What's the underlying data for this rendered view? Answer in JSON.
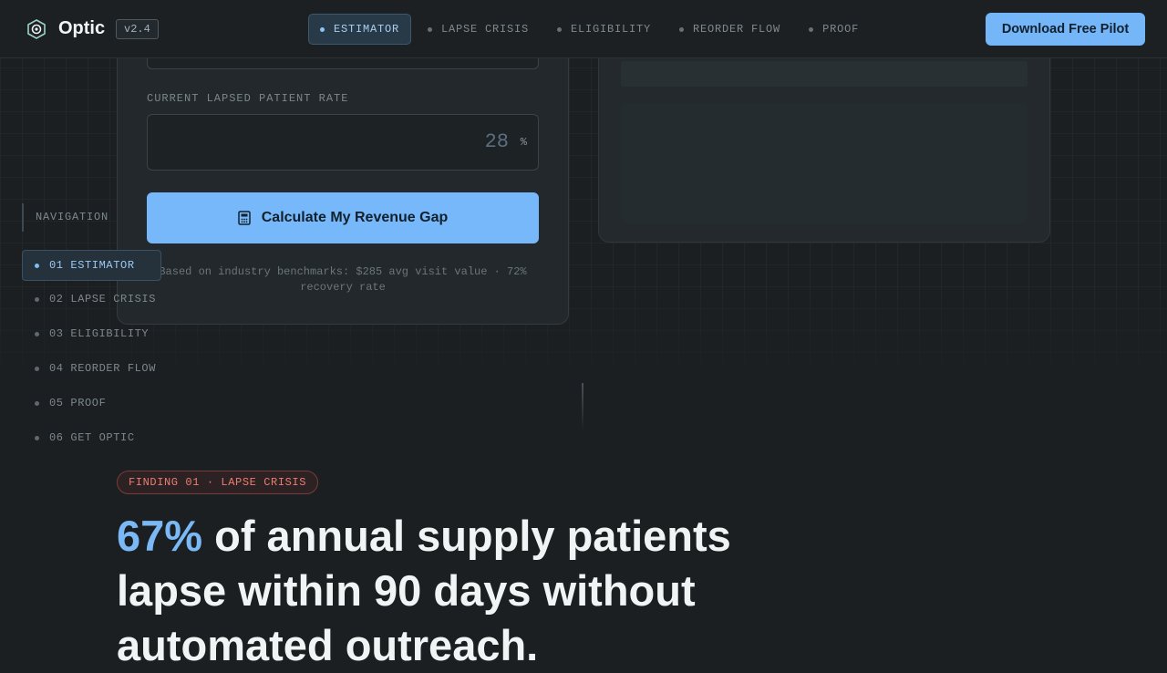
{
  "header": {
    "brand": "Optic",
    "version": "v2.4",
    "tabs": [
      {
        "label": "ESTIMATOR",
        "active": true
      },
      {
        "label": "LAPSE CRISIS",
        "active": false
      },
      {
        "label": "ELIGIBILITY",
        "active": false
      },
      {
        "label": "REORDER FLOW",
        "active": false
      },
      {
        "label": "PROOF",
        "active": false
      }
    ],
    "cta_label": "Download Free Pilot"
  },
  "estimator": {
    "lapsed_rate_label": "CURRENT LAPSED PATIENT RATE",
    "lapsed_rate_value": "28",
    "lapsed_rate_unit": "%",
    "calculate_label": "Calculate My Revenue Gap",
    "benchmark_note": "Based on industry benchmarks: $285 avg visit value · 72% recovery rate"
  },
  "sidenav": {
    "title": "NAVIGATION",
    "items": [
      {
        "label": "01 ESTIMATOR",
        "active": true
      },
      {
        "label": "02 LAPSE CRISIS",
        "active": false
      },
      {
        "label": "03 ELIGIBILITY",
        "active": false
      },
      {
        "label": "04 REORDER FLOW",
        "active": false
      },
      {
        "label": "05 PROOF",
        "active": false
      },
      {
        "label": "06 GET OPTIC",
        "active": false
      }
    ]
  },
  "finding": {
    "tag": "FINDING 01 · LAPSE CRISIS",
    "headline_highlight": "67%",
    "headline_rest": " of annual supply patients lapse within 90 days without automated outreach."
  },
  "colors": {
    "accent": "#76b8f9",
    "background": "#1b1f21",
    "finding_red": "#ea7d72"
  },
  "icons": {
    "logo": "optic-logo-icon",
    "calculate": "calculator-icon"
  }
}
